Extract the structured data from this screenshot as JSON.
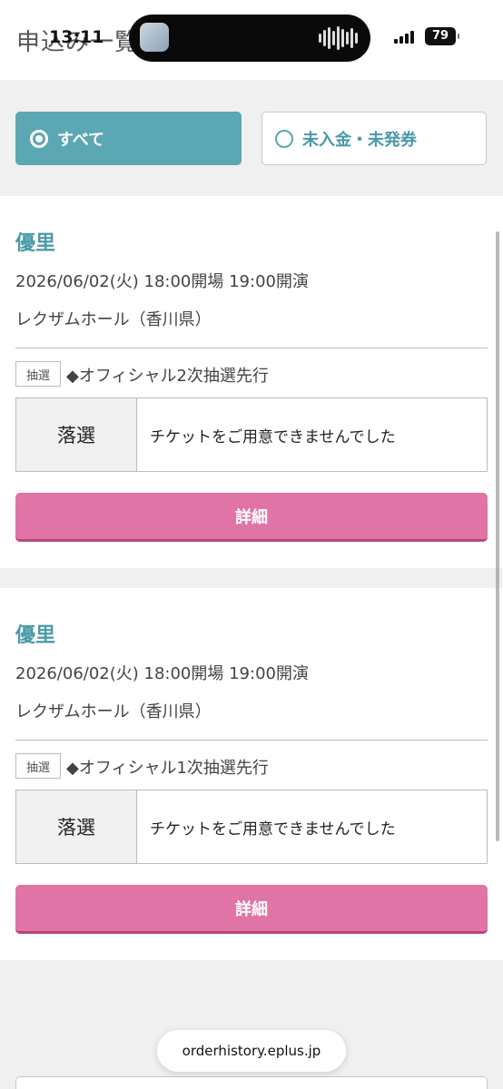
{
  "status_bar": {
    "time": "13:11",
    "battery": "79"
  },
  "page": {
    "title": "申込み一覧"
  },
  "filters": {
    "all_label": "すべて",
    "unpaid_label": "未入金・未発券"
  },
  "entries": [
    {
      "artist": "優里",
      "datetime": "2026/06/02(火) 18:00開場 19:00開演",
      "venue": "レクザムホール（香川県）",
      "badge": "抽選",
      "round": "◆オフィシャル2次抽選先行",
      "status": "落選",
      "message": "チケットをご用意できませんでした",
      "button": "詳細"
    },
    {
      "artist": "優里",
      "datetime": "2026/06/02(火) 18:00開場 19:00開演",
      "venue": "レクザムホール（香川県）",
      "badge": "抽選",
      "round": "◆オフィシャル1次抽選先行",
      "status": "落選",
      "message": "チケットをご用意できませんでした",
      "button": "詳細"
    }
  ],
  "browser": {
    "url": "orderhistory.eplus.jp"
  },
  "colors": {
    "accent": "#5ba7b3",
    "button": "#e174a6"
  }
}
